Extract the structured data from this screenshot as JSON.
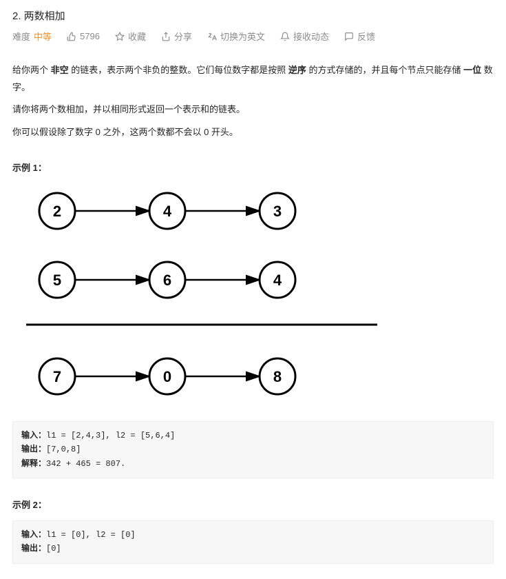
{
  "title": "2. 两数相加",
  "meta": {
    "difficulty_label": "难度",
    "difficulty_value": "中等",
    "likes": "5796",
    "favorite": "收藏",
    "share": "分享",
    "switch_lang": "切换为英文",
    "subscribe": "接收动态",
    "feedback": "反馈"
  },
  "description": {
    "p1_a": "给你两个 ",
    "p1_b": "非空",
    "p1_c": " 的链表，表示两个非负的整数。它们每位数字都是按照 ",
    "p1_d": "逆序",
    "p1_e": " 的方式存储的，并且每个节点只能存储 ",
    "p1_f": "一位",
    "p1_g": " 数字。",
    "p2": "请你将两个数相加，并以相同形式返回一个表示和的链表。",
    "p3": "你可以假设除了数字 0 之外，这两个数都不会以 0 开头。"
  },
  "example1": {
    "heading": "示例 1：",
    "diagram": {
      "row1": [
        "2",
        "4",
        "3"
      ],
      "row2": [
        "5",
        "6",
        "4"
      ],
      "row3": [
        "7",
        "0",
        "8"
      ]
    },
    "input_label": "输入：",
    "input_value": "l1 = [2,4,3], l2 = [5,6,4]",
    "output_label": "输出：",
    "output_value": "[7,0,8]",
    "explain_label": "解释：",
    "explain_value": "342 + 465 = 807."
  },
  "example2": {
    "heading": "示例 2：",
    "input_label": "输入：",
    "input_value": "l1 = [0], l2 = [0]",
    "output_label": "输出：",
    "output_value": "[0]"
  }
}
